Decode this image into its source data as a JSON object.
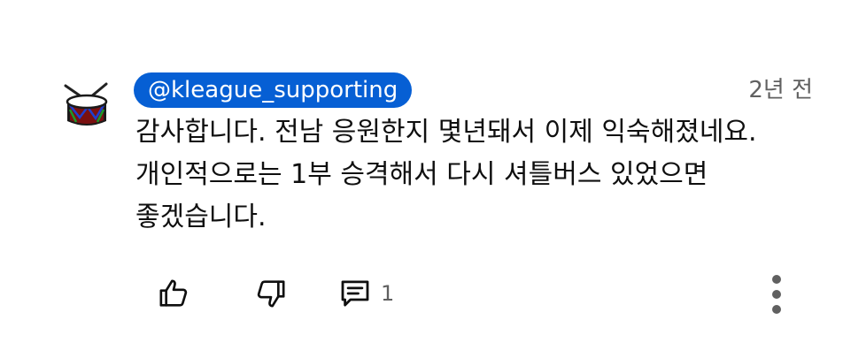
{
  "comment": {
    "author": "@kleague_supporting",
    "timestamp": "2년 전",
    "text": "감사합니다. 전남 응원한지 몇년돼서 이제 익숙해졌네요. 개인적으로는 1부 승격해서 다시 셔틀버스 있었으면 좋겠습니다.",
    "avatar_icon": "drum-icon",
    "author_chip_color": "#065fd4"
  },
  "actions": {
    "like_icon": "thumbs-up-icon",
    "dislike_icon": "thumbs-down-icon",
    "reply_icon": "comment-icon",
    "reply_count": "1",
    "more_icon": "more-vertical-icon"
  }
}
